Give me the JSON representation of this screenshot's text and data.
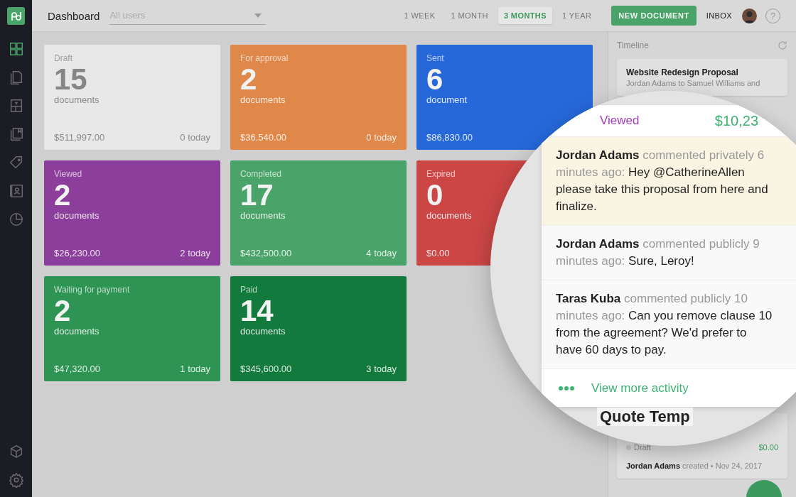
{
  "header": {
    "title": "Dashboard",
    "user_filter": {
      "placeholder": "All users"
    },
    "periods": [
      {
        "label": "1 WEEK",
        "selected": false
      },
      {
        "label": "1 MONTH",
        "selected": false
      },
      {
        "label": "3 MONTHS",
        "selected": true
      },
      {
        "label": "1 YEAR",
        "selected": false
      }
    ],
    "new_button": "NEW DOCUMENT",
    "inbox": "INBOX",
    "help": "?"
  },
  "sidebar": {
    "items": [
      {
        "kind": "grid",
        "selected": true
      },
      {
        "kind": "docs",
        "selected": false
      },
      {
        "kind": "template",
        "selected": false
      },
      {
        "kind": "library",
        "selected": false
      },
      {
        "kind": "tag",
        "selected": false
      },
      {
        "kind": "contact",
        "selected": false
      },
      {
        "kind": "chart",
        "selected": false
      }
    ],
    "bottom": [
      {
        "kind": "box"
      },
      {
        "kind": "gear"
      }
    ]
  },
  "cards": [
    {
      "status": "Draft",
      "count": "15",
      "unit": "documents",
      "amount": "$511,997.00",
      "today": "0 today",
      "color": "#e8e8e8"
    },
    {
      "status": "For approval",
      "count": "2",
      "unit": "documents",
      "amount": "$36,540.00",
      "today": "0 today",
      "color": "#e0874a"
    },
    {
      "status": "Sent",
      "count": "6",
      "unit": "document",
      "amount": "$86,830.00",
      "color": "#2668d9"
    },
    {
      "status": "Viewed",
      "count": "2",
      "unit": "documents",
      "amount": "$26,230.00",
      "today": "2 today",
      "color": "#8b3e9b"
    },
    {
      "status": "Completed",
      "count": "17",
      "unit": "documents",
      "amount": "$432,500.00",
      "today": "4 today",
      "color": "#4aa46a"
    },
    {
      "status": "Expired",
      "count": "0",
      "unit": "documents",
      "amount": "$0.00",
      "color": "#cc4646"
    },
    {
      "status": "Waiting for payment",
      "count": "2",
      "unit": "documents",
      "amount": "$47,320.00",
      "today": "1 today",
      "color": "#2e9454"
    },
    {
      "status": "Paid",
      "count": "14",
      "unit": "documents",
      "amount": "$345,600.00",
      "today": "3 today",
      "color": "#137a3d"
    }
  ],
  "timeline": {
    "title": "Timeline",
    "top_card": {
      "title": "Website Redesign Proposal",
      "subtitle": "Jordan Adams to Samuel Williams and"
    },
    "bottom_card": {
      "status": "Draft",
      "amount": "$0.00",
      "author": "Jordan Adams",
      "action": "created • Nov 24, 2017"
    }
  },
  "magnifier": {
    "status": "Viewed",
    "amount": "$10,23",
    "comments": [
      {
        "author": "Jordan Adams",
        "meta": "commented privately 6 minutes ago:",
        "text": "Hey @CatherineAllen please take this proposal from here and finalize.",
        "private": true
      },
      {
        "author": "Jordan Adams",
        "meta": "commented publicly 9 minutes ago:",
        "text": "Sure, Leroy!",
        "private": false
      },
      {
        "author": "Taras Kuba",
        "meta": "commented publicly 10 minutes ago:",
        "text": "Can you remove clause 10 from the agreement? We'd prefer to have 60 days to pay.",
        "private": false
      }
    ],
    "more": "View more activity",
    "next_title": "Quote Temp"
  }
}
